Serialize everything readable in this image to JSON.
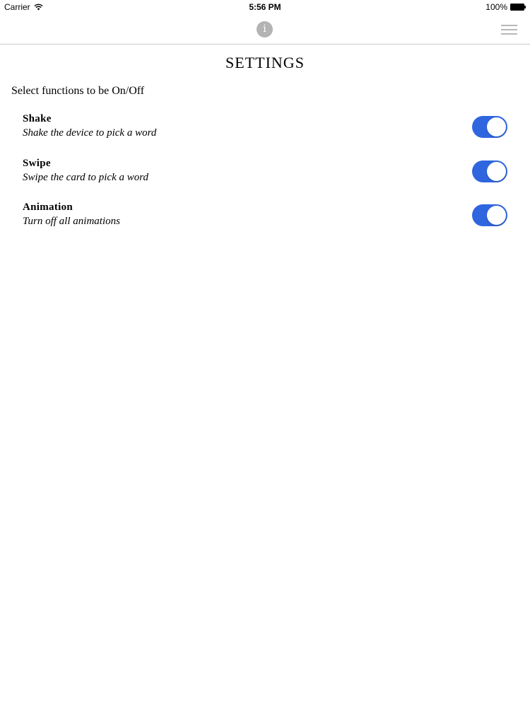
{
  "status_bar": {
    "carrier": "Carrier",
    "time": "5:56 PM",
    "battery": "100%"
  },
  "nav": {
    "info_icon": "info-icon",
    "info_glyph": "i",
    "menu_icon": "hamburger-menu-icon"
  },
  "page": {
    "title": "SETTINGS",
    "subtitle": "Select functions to be On/Off"
  },
  "settings": [
    {
      "name": "Shake",
      "description": "Shake the device to pick a word",
      "enabled": true
    },
    {
      "name": "Swipe",
      "description": "Swipe the card to pick a word",
      "enabled": true
    },
    {
      "name": "Animation",
      "description": "Turn off all animations",
      "enabled": true
    }
  ],
  "colors": {
    "toggle_on": "#2f66e0",
    "icon_gray": "#b3b3b3",
    "divider": "#c8c8c8"
  }
}
